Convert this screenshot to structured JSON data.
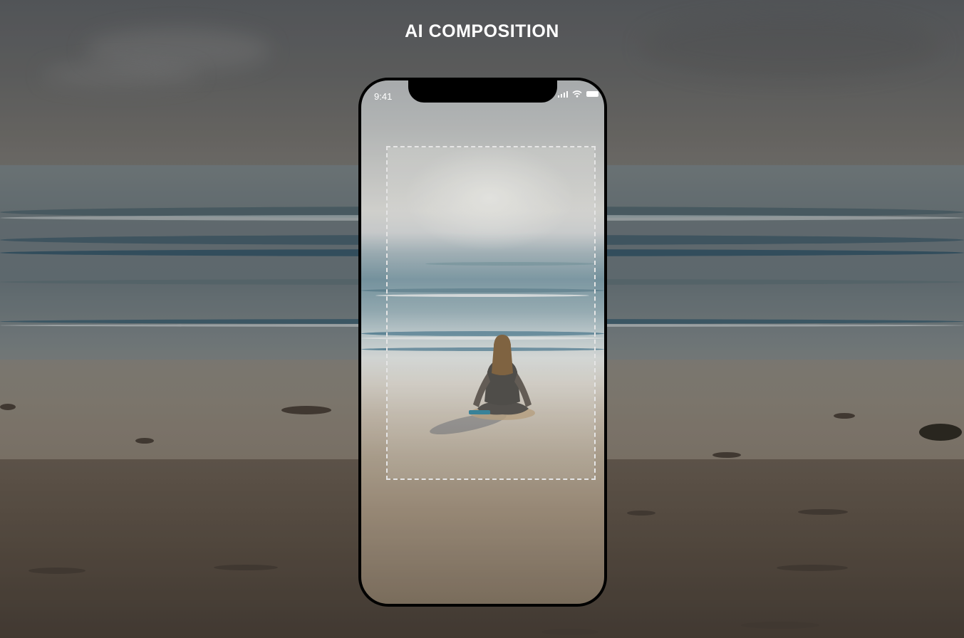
{
  "page": {
    "title": "AI COMPOSITION"
  },
  "phone": {
    "status_time": "9:41",
    "status_icons": [
      "cellular-signal-icon",
      "wifi-icon",
      "battery-icon"
    ]
  },
  "colors": {
    "title_text": "#ffffff",
    "phone_frame": "#000000",
    "crop_frame": "#ffffff"
  }
}
